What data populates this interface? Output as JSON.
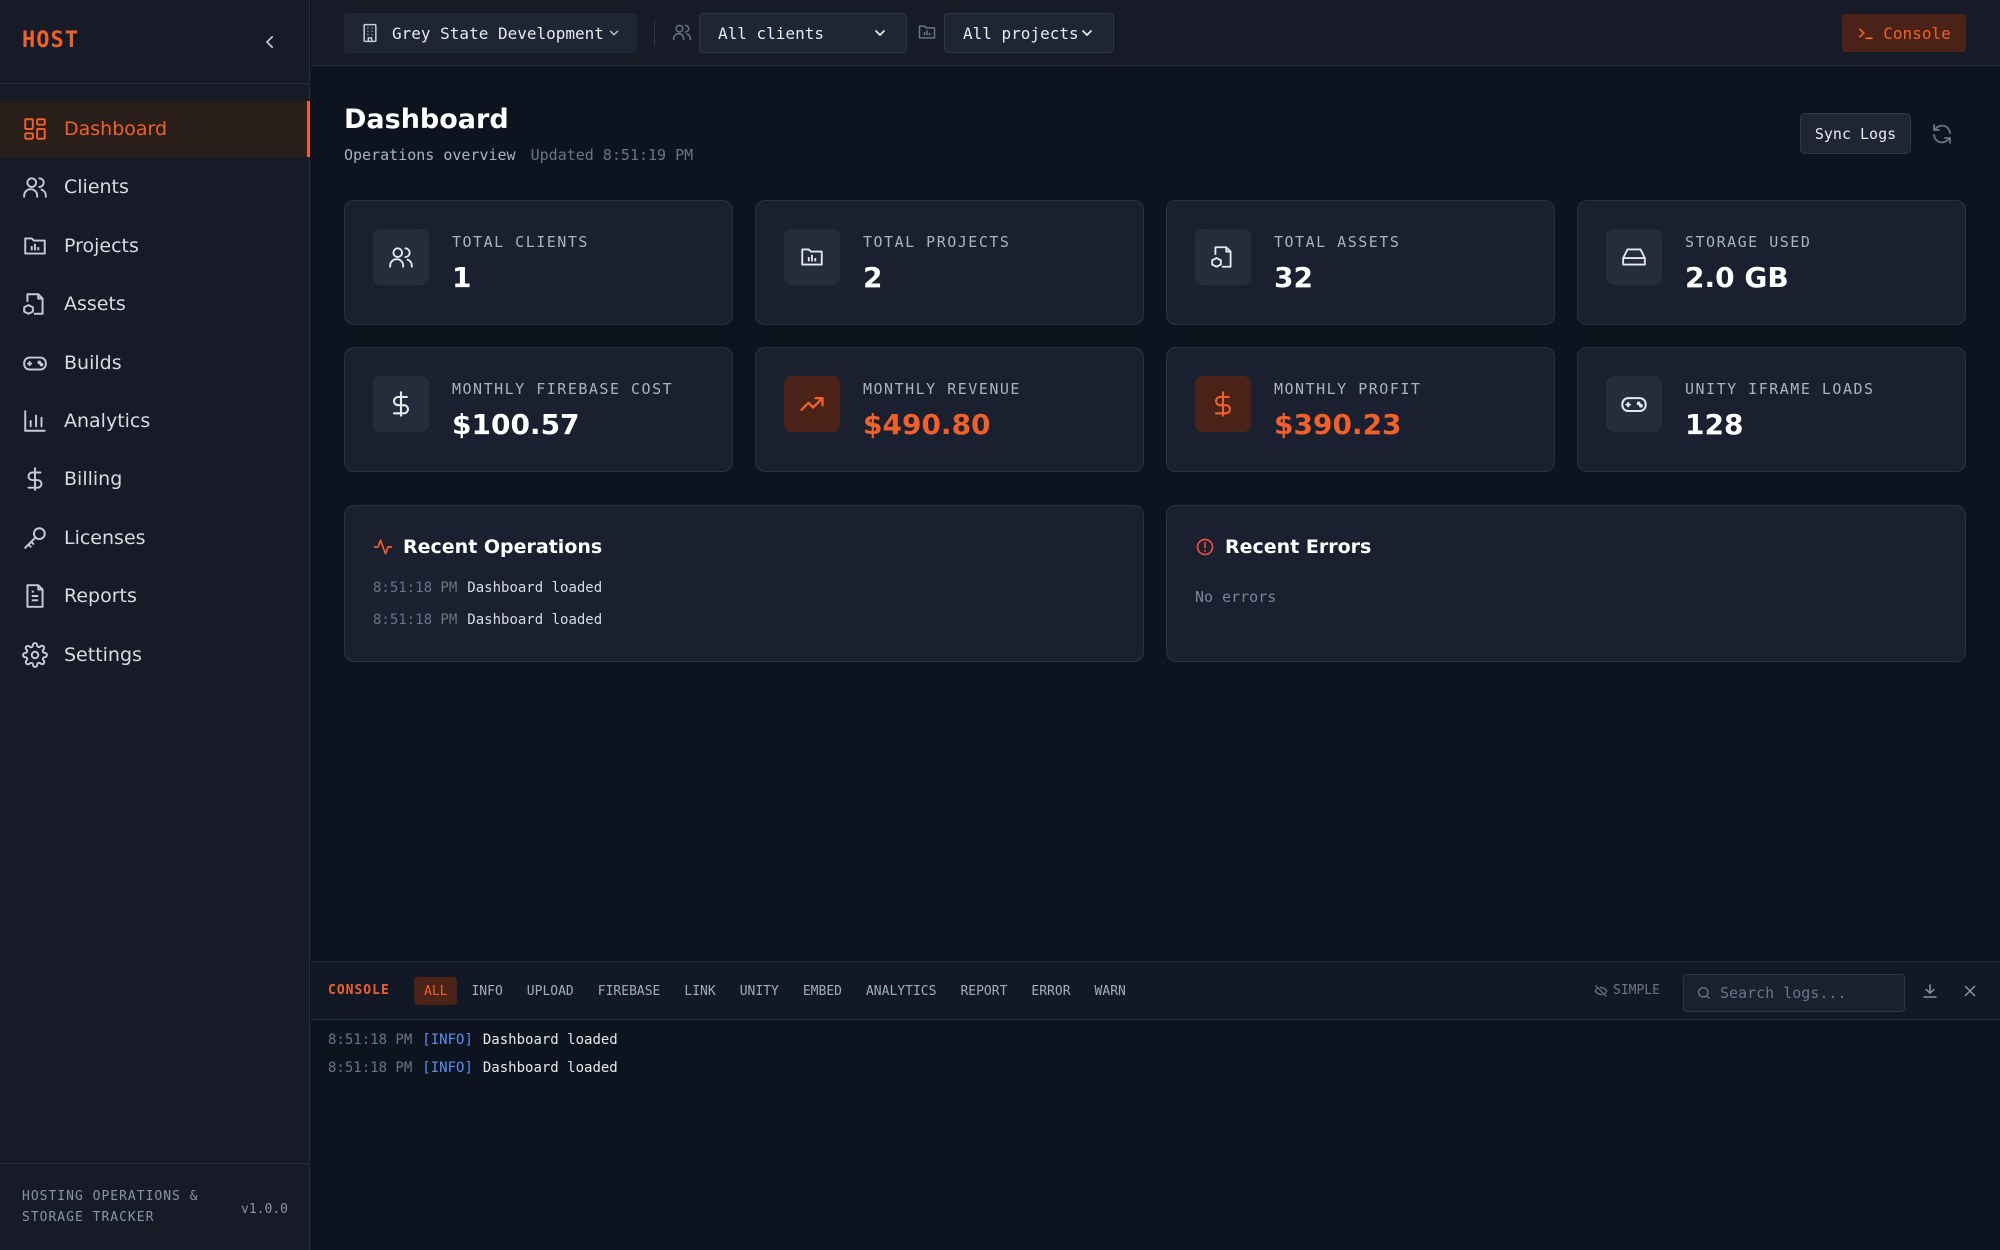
{
  "app": {
    "brand": "HOST",
    "footer_text": "HOSTING OPERATIONS & STORAGE TRACKER",
    "version": "v1.0.0",
    "accent_color": "#f0602a"
  },
  "sidebar": {
    "items": [
      {
        "label": "Dashboard",
        "icon": "dashboard-icon",
        "active": true
      },
      {
        "label": "Clients",
        "icon": "users-icon"
      },
      {
        "label": "Projects",
        "icon": "folder-icon"
      },
      {
        "label": "Assets",
        "icon": "file-box-icon"
      },
      {
        "label": "Builds",
        "icon": "gamepad-icon"
      },
      {
        "label": "Analytics",
        "icon": "bar-chart-icon"
      },
      {
        "label": "Billing",
        "icon": "dollar-icon"
      },
      {
        "label": "Licenses",
        "icon": "key-icon"
      },
      {
        "label": "Reports",
        "icon": "file-text-icon"
      },
      {
        "label": "Settings",
        "icon": "gear-icon"
      }
    ]
  },
  "topbar": {
    "organization": "Grey State Development",
    "client_filter": {
      "selected": "All clients",
      "options": [
        "All clients"
      ]
    },
    "project_filter": {
      "selected": "All projects",
      "options": [
        "All projects"
      ]
    },
    "console_label": "Console"
  },
  "page": {
    "title": "Dashboard",
    "subtitle": "Operations overview",
    "updated": "Updated 8:51:19 PM",
    "sync_label": "Sync Logs"
  },
  "stats": [
    {
      "label": "TOTAL CLIENTS",
      "value": "1",
      "icon": "users-icon",
      "accent": false
    },
    {
      "label": "TOTAL PROJECTS",
      "value": "2",
      "icon": "folder-icon",
      "accent": false
    },
    {
      "label": "TOTAL ASSETS",
      "value": "32",
      "icon": "file-box-icon",
      "accent": false
    },
    {
      "label": "STORAGE USED",
      "value": "2.0 GB",
      "icon": "hard-drive-icon",
      "accent": false
    },
    {
      "label": "MONTHLY FIREBASE COST",
      "value": "$100.57",
      "icon": "dollar-icon",
      "accent": false
    },
    {
      "label": "MONTHLY REVENUE",
      "value": "$490.80",
      "icon": "trending-up-icon",
      "accent": true
    },
    {
      "label": "MONTHLY PROFIT",
      "value": "$390.23",
      "icon": "dollar-icon",
      "accent": true
    },
    {
      "label": "UNITY IFRAME LOADS",
      "value": "128",
      "icon": "gamepad-icon",
      "accent": false
    }
  ],
  "recent_operations": {
    "title": "Recent Operations",
    "items": [
      {
        "time": "8:51:18 PM",
        "message": "Dashboard loaded"
      },
      {
        "time": "8:51:18 PM",
        "message": "Dashboard loaded"
      }
    ]
  },
  "recent_errors": {
    "title": "Recent Errors",
    "empty_text": "No errors"
  },
  "console": {
    "label": "CONSOLE",
    "tabs": [
      "ALL",
      "INFO",
      "UPLOAD",
      "FIREBASE",
      "LINK",
      "UNITY",
      "EMBED",
      "ANALYTICS",
      "REPORT",
      "ERROR",
      "WARN"
    ],
    "active_tab": "ALL",
    "simple_label": "SIMPLE",
    "search_placeholder": "Search logs...",
    "logs": [
      {
        "time": "8:51:18 PM",
        "level": "[INFO]",
        "message": "Dashboard loaded"
      },
      {
        "time": "8:51:18 PM",
        "level": "[INFO]",
        "message": "Dashboard loaded"
      }
    ]
  }
}
